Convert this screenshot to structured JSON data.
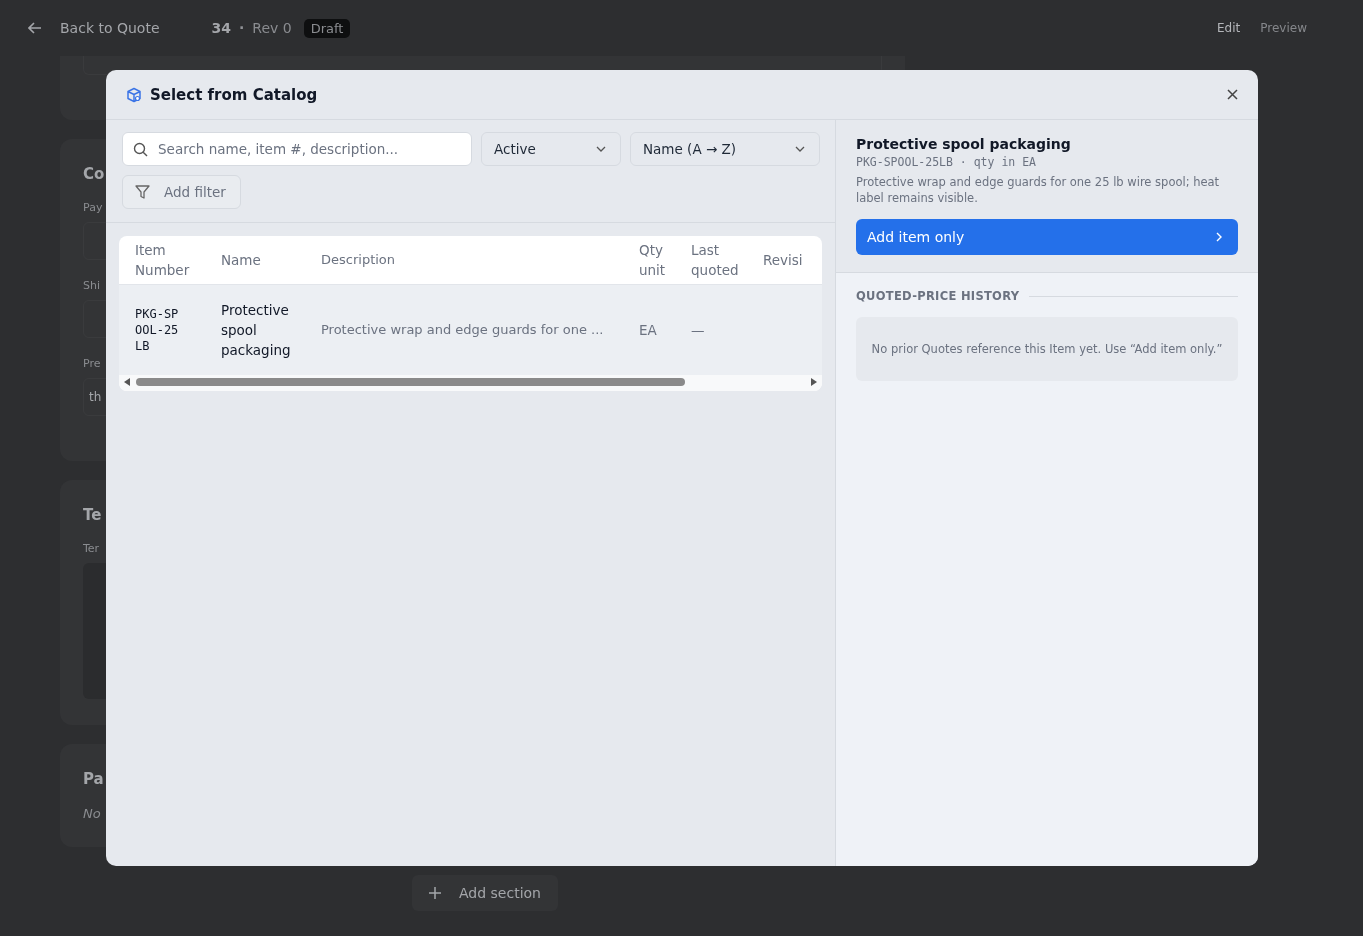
{
  "top_bar": {
    "back_label": "Back to Quote",
    "quote_number": "34",
    "separator": "·",
    "revision": "Rev 0",
    "status_badge": "Draft",
    "modes": [
      {
        "label": "Edit",
        "selected": true
      },
      {
        "label": "Preview",
        "selected": false
      }
    ]
  },
  "background_cards": [
    {
      "kind": "tail"
    },
    {
      "title": "Co",
      "fields": [
        {
          "label": "Pay"
        },
        {
          "label": "Shi"
        },
        {
          "label": "Pre",
          "value": "th"
        }
      ],
      "kind": "fields"
    },
    {
      "title": "Te",
      "fields": [
        {
          "label": "Ter"
        }
      ],
      "kind": "textarea"
    },
    {
      "title": "Pa",
      "note": "No",
      "kind": "note"
    }
  ],
  "add_section_label": "Add section",
  "dialog": {
    "title": "Select from Catalog",
    "search": {
      "placeholder": "Search name, item #, description..."
    },
    "status_filter": "Active",
    "sort": "Name (A → Z)",
    "add_filter_label": "Add filter",
    "table": {
      "columns": [
        "Item Number",
        "Name",
        "Description",
        "Qty unit",
        "Last quoted",
        "Revisi"
      ],
      "rows": [
        {
          "item_number": "PKG-SPOOL-25LB",
          "name": "Protective spool packaging",
          "description": "Protective wrap and edge guards for one ...",
          "qty_unit": "EA",
          "last_quoted": "—",
          "selected": true
        }
      ]
    },
    "detail": {
      "name": "Protective spool packaging",
      "meta": "PKG-SPOOL-25LB · qty in EA",
      "description": "Protective wrap and edge guards for one 25 lb wire spool; heat label remains visible.",
      "action_label": "Add item only",
      "history_title": "QUOTED-PRICE HISTORY",
      "history_empty": "No prior Quotes reference this Item yet. Use “Add item only.”"
    }
  }
}
